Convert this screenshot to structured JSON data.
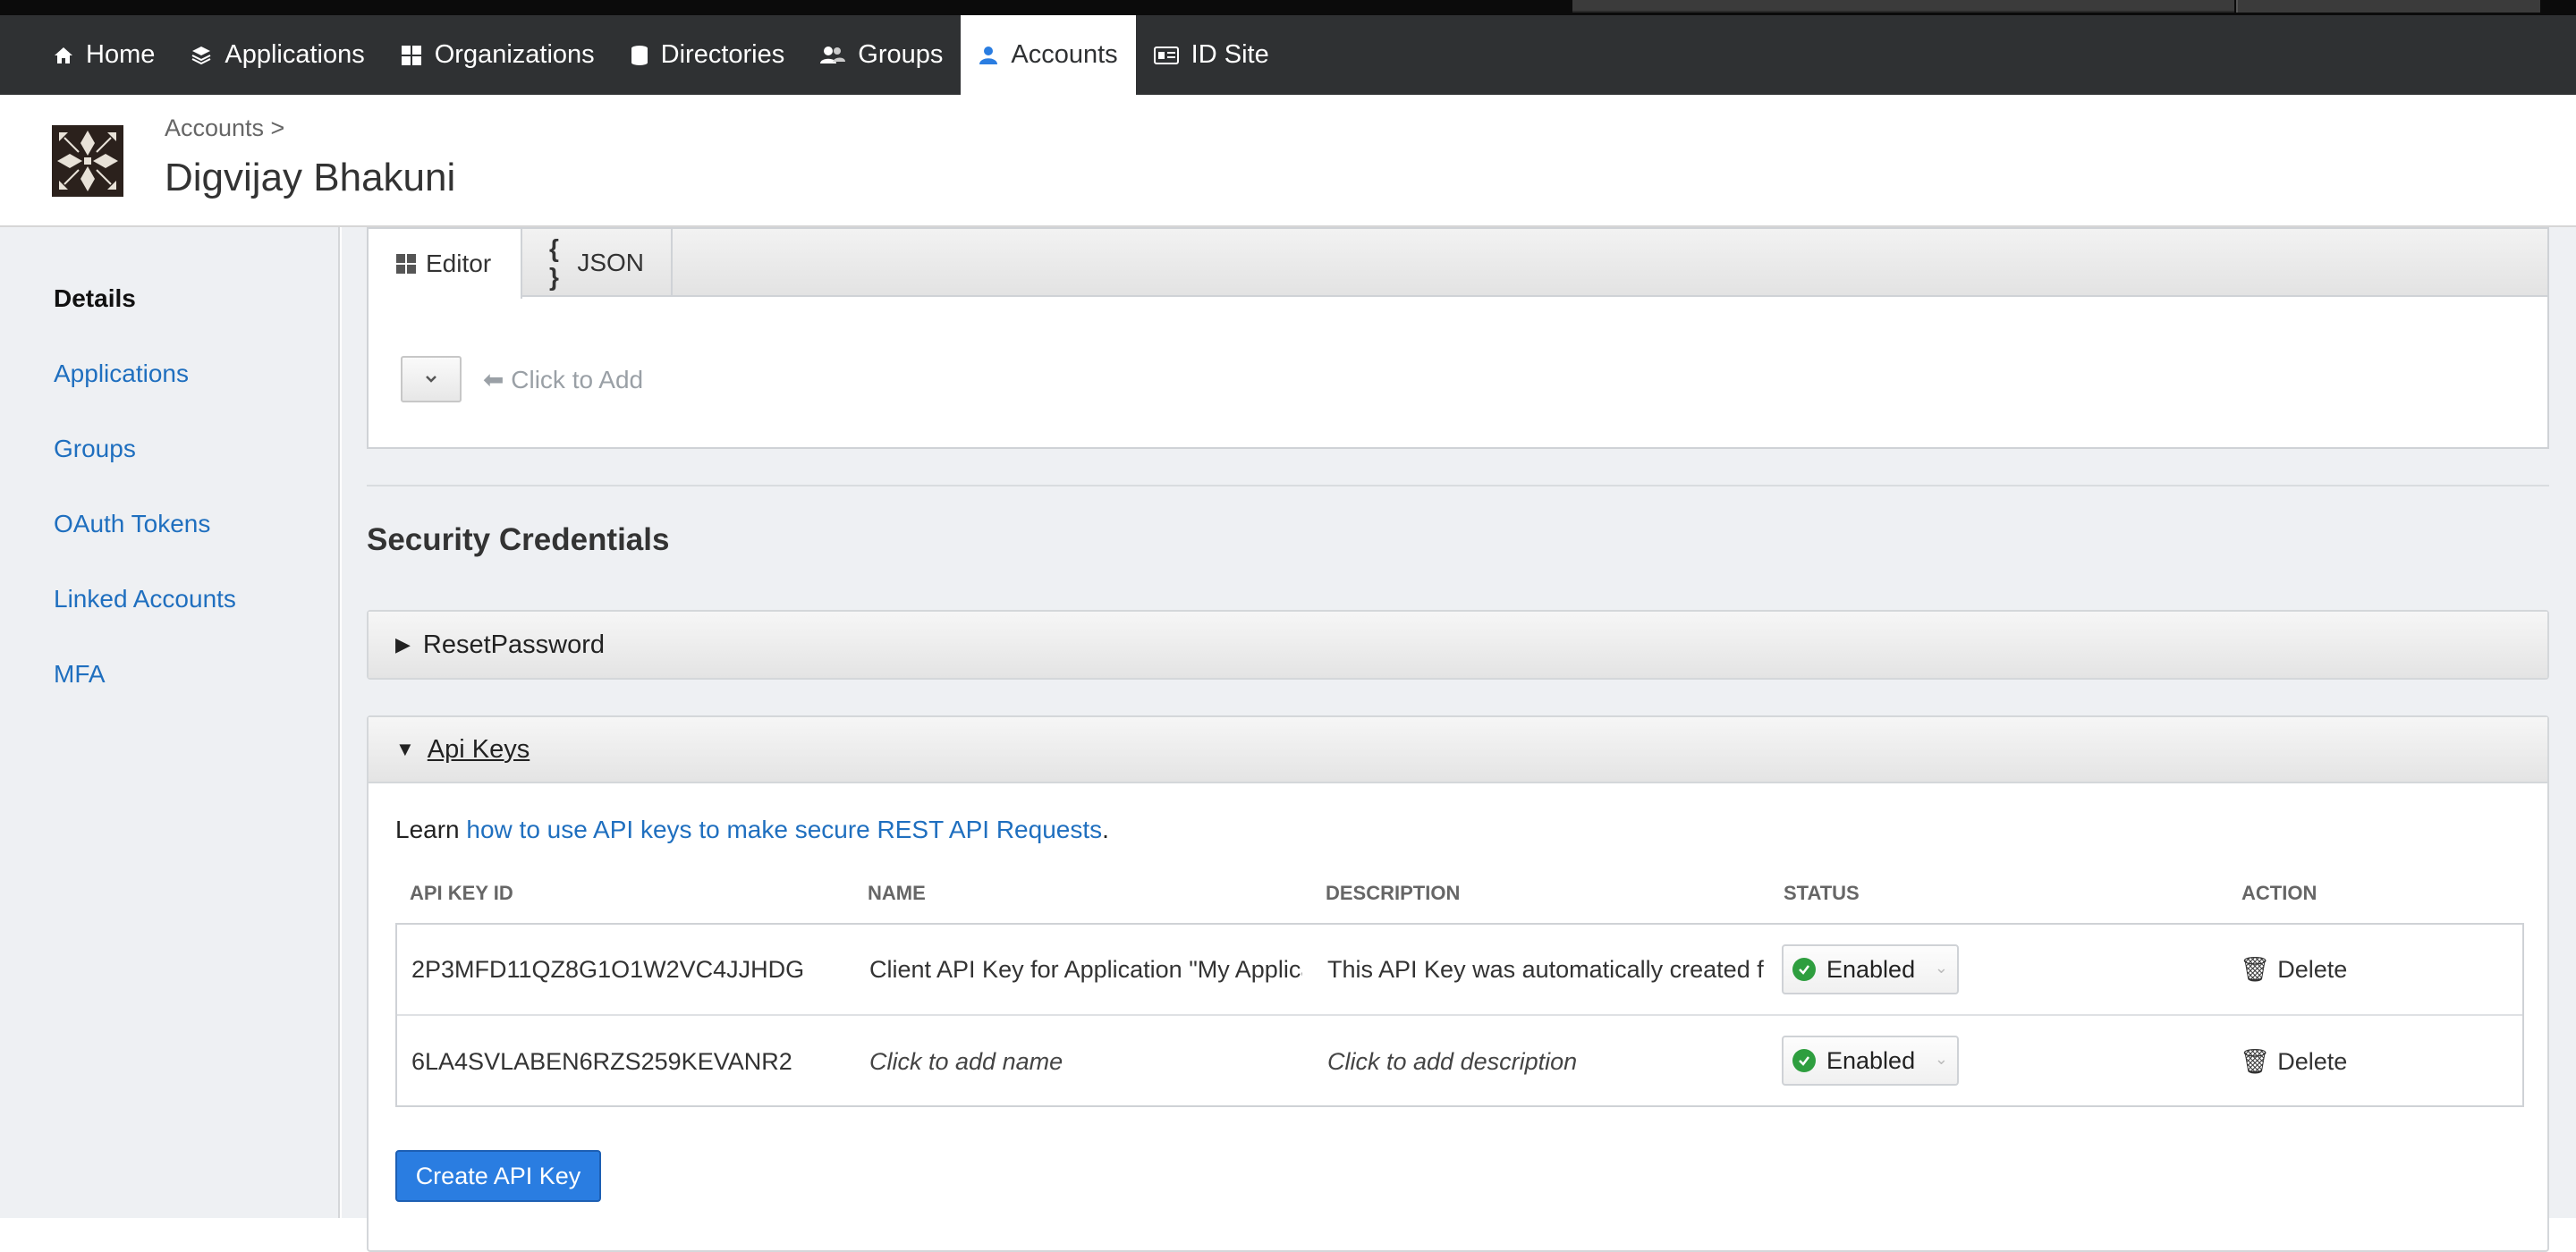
{
  "nav": {
    "items": [
      {
        "label": "Home",
        "icon": "home-icon"
      },
      {
        "label": "Applications",
        "icon": "layers-icon"
      },
      {
        "label": "Organizations",
        "icon": "grid-icon"
      },
      {
        "label": "Directories",
        "icon": "database-icon"
      },
      {
        "label": "Groups",
        "icon": "users-icon"
      },
      {
        "label": "Accounts",
        "icon": "user-icon",
        "active": true
      },
      {
        "label": "ID Site",
        "icon": "id-card-icon"
      }
    ]
  },
  "header": {
    "breadcrumb": "Accounts >",
    "title": "Digvijay Bhakuni"
  },
  "sidebar": {
    "items": [
      {
        "label": "Details",
        "active": true
      },
      {
        "label": "Applications"
      },
      {
        "label": "Groups"
      },
      {
        "label": "OAuth Tokens"
      },
      {
        "label": "Linked Accounts"
      },
      {
        "label": "MFA"
      }
    ]
  },
  "editor": {
    "tabs": [
      {
        "label": "Editor",
        "icon": "grid-icon"
      },
      {
        "label": "JSON",
        "icon": "braces-icon"
      }
    ],
    "add_hint": "Click to Add"
  },
  "security": {
    "title": "Security Credentials",
    "reset_password_label": "ResetPassword",
    "api_keys_label": "Api Keys",
    "learn_prefix": "Learn ",
    "learn_link": "how to use API keys to make secure REST API Requests",
    "learn_suffix": ".",
    "columns": [
      "API KEY ID",
      "NAME",
      "DESCRIPTION",
      "STATUS",
      "ACTION"
    ],
    "rows": [
      {
        "id": "2P3MFD11QZ8G1O1W2VC4JJHDG",
        "name": "Client API Key for Application \"My Applica",
        "description": "This API Key was automatically created for",
        "status": "Enabled",
        "action": "Delete"
      },
      {
        "id": "6LA4SVLABEN6RZS259KEVANR2",
        "name": "Click to add name",
        "description": "Click to add description",
        "status": "Enabled",
        "action": "Delete"
      }
    ],
    "create_button": "Create API Key"
  },
  "colors": {
    "navbar": "#2f3133",
    "link": "#1f6fbf",
    "primary_button": "#2a7de1",
    "enabled_green": "#2e9e3f",
    "sidebar_bg": "#eef0f3"
  }
}
